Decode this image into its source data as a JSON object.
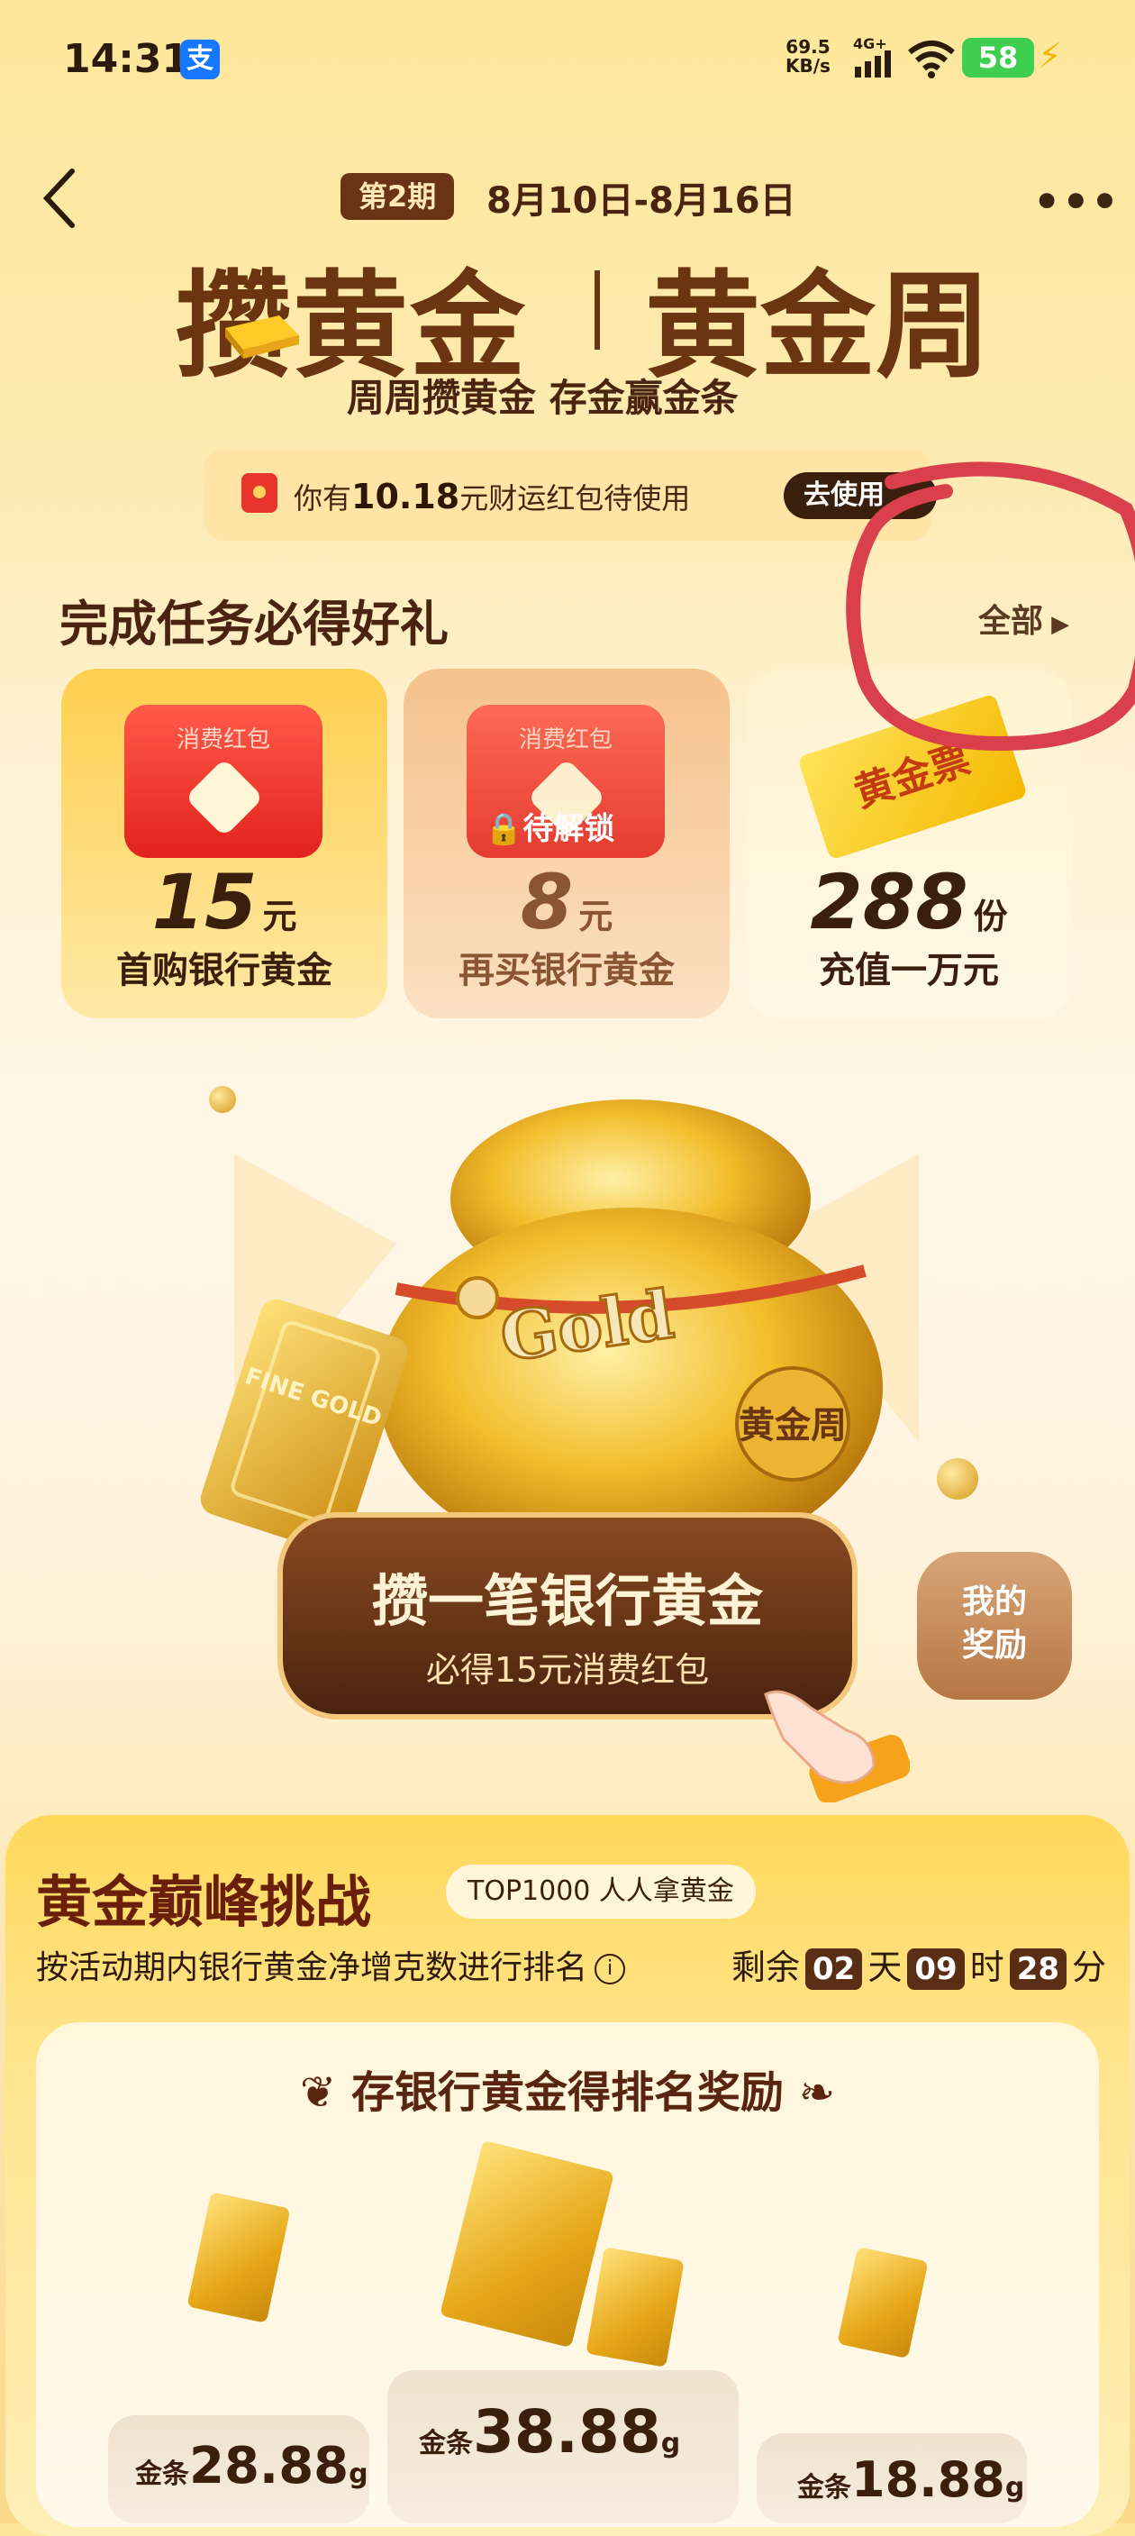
{
  "status_bar": {
    "time": "14:31",
    "app_badge": "支",
    "net_speed_value": "69.5",
    "net_speed_unit": "KB/s",
    "network": "4G+",
    "battery": "58"
  },
  "header": {
    "period_badge": "第2期",
    "period_dates": "8月10日-8月16日",
    "title_main": "攒黄金",
    "title_side": "黄金周",
    "subtitle": "周周攒黄金 存金赢金条"
  },
  "red_packet_bar": {
    "text_prefix": "你有",
    "amount": "10.18",
    "text_suffix": "元财运红包待使用",
    "button_label": "去使用"
  },
  "tasks": {
    "title": "完成任务必得好礼",
    "all_label": "全部",
    "cards": [
      {
        "packet_label": "消费红包",
        "amount": "15",
        "unit": "元",
        "label": "首购银行黄金"
      },
      {
        "packet_label": "消费红包",
        "lock_label": "待解锁",
        "amount": "8",
        "unit": "元",
        "label": "再买银行黄金"
      },
      {
        "ticket_label": "黄金票",
        "amount": "288",
        "unit": "份",
        "label": "充值一万元"
      }
    ]
  },
  "hero": {
    "bag_text": "Gold",
    "bag_stamp": "黄金周",
    "bar_text": "FINE GOLD",
    "cta_main": "攒一笔银行黄金",
    "cta_sub": "必得15元消费红包",
    "my_reward_line1": "我的",
    "my_reward_line2": "奖励"
  },
  "challenge": {
    "title": "黄金巅峰挑战",
    "badge": "TOP1000 人人拿黄金",
    "rule": "按活动期内银行黄金净增克数进行排名",
    "countdown_prefix": "剩余",
    "days": "02",
    "days_unit": "天",
    "hours": "09",
    "hours_unit": "时",
    "minutes": "28",
    "minutes_unit": "分",
    "panel_title": "存银行黄金得排名奖励",
    "prizes": [
      {
        "prefix": "金条",
        "weight": "28.88",
        "unit": "g"
      },
      {
        "prefix": "金条",
        "weight": "38.88",
        "unit": "g"
      },
      {
        "prefix": "金条",
        "weight": "18.88",
        "unit": "g"
      }
    ]
  },
  "colors": {
    "brand_brown": "#6a3510",
    "cta_brown": "#4a230e",
    "red_packet": "#e2221d",
    "annotation": "#d9404c"
  }
}
